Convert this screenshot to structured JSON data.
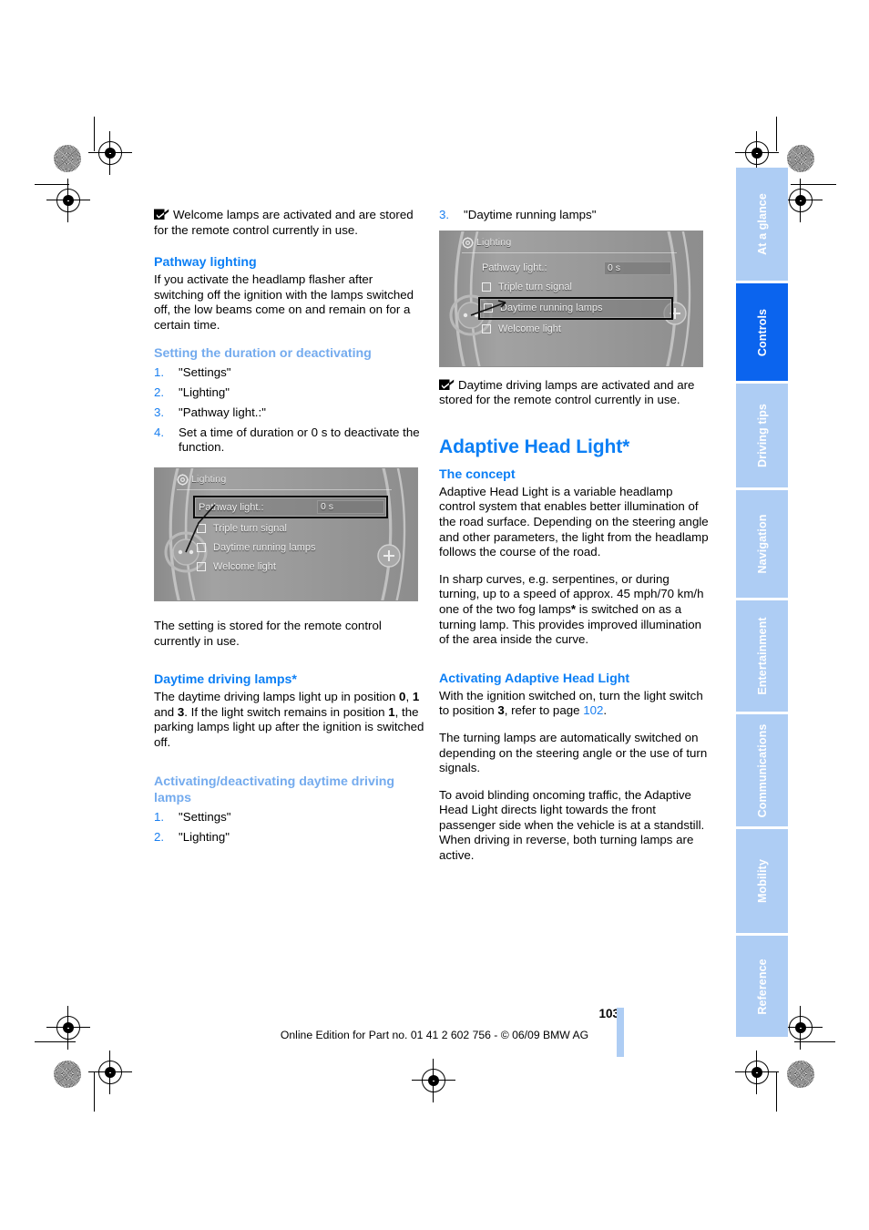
{
  "document": {
    "page_number": "103",
    "edition_line": "Online Edition for Part no. 01 41 2 602 756 - © 06/09 BMW AG"
  },
  "sidebar": {
    "tabs": [
      {
        "label": "At a glance",
        "active": false
      },
      {
        "label": "Controls",
        "active": true
      },
      {
        "label": "Driving tips",
        "active": false
      },
      {
        "label": "Navigation",
        "active": false
      },
      {
        "label": "Entertainment",
        "active": false
      },
      {
        "label": "Communications",
        "active": false
      },
      {
        "label": "Mobility",
        "active": false
      },
      {
        "label": "Reference",
        "active": false
      }
    ],
    "colors": {
      "inactive": "#aecdf4",
      "active": "#0b64ee",
      "label": "#ffffff"
    }
  },
  "colors": {
    "heading": "#0c7ff5",
    "subheading": "#74abee",
    "list_number": "#1a7ff0",
    "page_link": "#1a7ff0",
    "body": "#000000"
  },
  "left_column": {
    "note_1": "Welcome lamps are activated and are stored for the remote control currently in use.",
    "h_pathway": "Pathway lighting",
    "p_pathway": "If you activate the headlamp flasher after switching off the ignition with the lamps switched off, the low beams come on and remain on for a certain time.",
    "h_setting": "Setting the duration or deactivating",
    "steps_setting": [
      {
        "num": "1.",
        "text": "\"Settings\""
      },
      {
        "num": "2.",
        "text": "\"Lighting\""
      },
      {
        "num": "3.",
        "text": "\"Pathway light.:\""
      },
      {
        "num": "4.",
        "text": "Set a time of duration or 0 s to deactivate the function."
      }
    ],
    "p_stored": "The setting is stored for the remote control currently in use.",
    "h_daytime": "Daytime driving lamps*",
    "p_daytime": "The daytime driving lamps light up in position 0, 1 and 3. If the light switch remains in position 1, the parking lamps light up after the ignition is switched off.",
    "h_activating_daytime": "Activating/deactivating daytime driving lamps",
    "steps_daytime": [
      {
        "num": "1.",
        "text": "\"Settings\""
      },
      {
        "num": "2.",
        "text": "\"Lighting\""
      }
    ]
  },
  "right_column": {
    "step_3": {
      "num": "3.",
      "text": "\"Daytime running lamps\""
    },
    "note_2": "Daytime driving lamps are activated and are stored for the remote control currently in use.",
    "h_adaptive": "Adaptive Head Light*",
    "h_concept": "The concept",
    "p_concept_1": "Adaptive Head Light is a variable headlamp control system that enables better illumination of the road surface. Depending on the steering angle and other parameters, the light from the headlamp follows the course of the road.",
    "p_concept_2": "In sharp curves, e.g. serpentines, or during turning, up to a speed of approx. 45 mph/70 km/h one of the two fog lamps* is switched on as a turning lamp. This provides improved illumination of the area inside the curve.",
    "h_activating_ahl": "Activating Adaptive Head Light",
    "p_ahl_1_before": "With the ignition switched on, turn the light switch to position ",
    "p_ahl_1_pos": "3",
    "p_ahl_1_mid": ", refer to page ",
    "p_ahl_1_page": "102",
    "p_ahl_1_after": ".",
    "p_ahl_2": "The turning lamps are automatically switched on depending on the steering angle or the use of turn signals.",
    "p_ahl_3": "To avoid blinding oncoming traffic, the Adaptive Head Light directs light towards the front passenger side when the vehicle is at a standstill. When driving in reverse, both turning lamps are active."
  },
  "idrive_left": {
    "title": "Lighting",
    "rows": [
      {
        "label": "Pathway light.:",
        "value": "0 s",
        "checkbox": false,
        "selected": true
      },
      {
        "label": "Triple turn signal",
        "value": "",
        "checkbox": true,
        "selected": false
      },
      {
        "label": "Daytime running lamps",
        "value": "",
        "checkbox": true,
        "selected": false
      },
      {
        "label": "Welcome light",
        "value": "",
        "checkbox": true,
        "selected": false
      }
    ],
    "right_knob": "+"
  },
  "idrive_right": {
    "title": "Lighting",
    "rows": [
      {
        "label": "Pathway light.:",
        "value": "0 s",
        "checkbox": false,
        "selected": false
      },
      {
        "label": "Triple turn signal",
        "value": "",
        "checkbox": true,
        "selected": false
      },
      {
        "label": "Daytime running lamps",
        "value": "",
        "checkbox": true,
        "selected": true
      },
      {
        "label": "Welcome light",
        "value": "",
        "checkbox": true,
        "selected": false
      }
    ],
    "right_knob": "+"
  }
}
